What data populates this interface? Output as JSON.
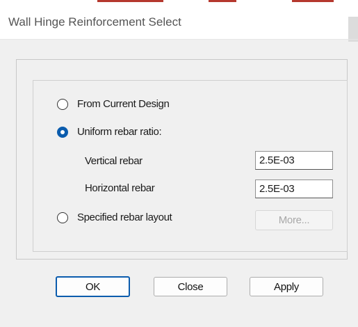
{
  "window": {
    "title": "Wall Hinge Reinforcement Select"
  },
  "options": {
    "from_current_design": {
      "label": "From Current Design",
      "checked": false
    },
    "uniform_rebar_ratio": {
      "label": "Uniform rebar ratio:",
      "checked": true
    },
    "specified_rebar_layout": {
      "label": "Specified rebar layout",
      "checked": false
    }
  },
  "fields": {
    "vertical_rebar": {
      "label": "Vertical rebar",
      "value": "2.5E-03"
    },
    "horizontal_rebar": {
      "label": "Horizontal rebar",
      "value": "2.5E-03"
    }
  },
  "buttons": {
    "more": {
      "label": "More...",
      "enabled": false
    },
    "ok": {
      "label": "OK"
    },
    "close": {
      "label": "Close"
    },
    "apply": {
      "label": "Apply"
    }
  },
  "colors": {
    "accent": "#0b5cad",
    "background": "#f0f0f0",
    "titlebar": "#ffffff"
  }
}
